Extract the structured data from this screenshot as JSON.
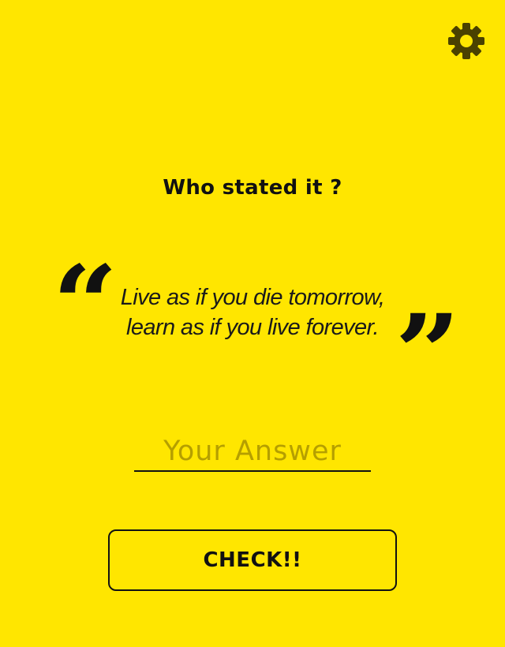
{
  "settings": {
    "icon": "gear-icon",
    "color": "#4A4100"
  },
  "question": {
    "text": "Who stated it ?"
  },
  "quote": {
    "open_mark": "“",
    "close_mark": "”",
    "lines": [
      "Live as if you die tomorrow,",
      "learn as if you live forever."
    ]
  },
  "answer": {
    "value": "",
    "placeholder": "Your Answer"
  },
  "check_button": {
    "label": "CHECK!!"
  },
  "colors": {
    "background": "#FFE600",
    "text": "#111111",
    "placeholder": "#B59F00"
  }
}
